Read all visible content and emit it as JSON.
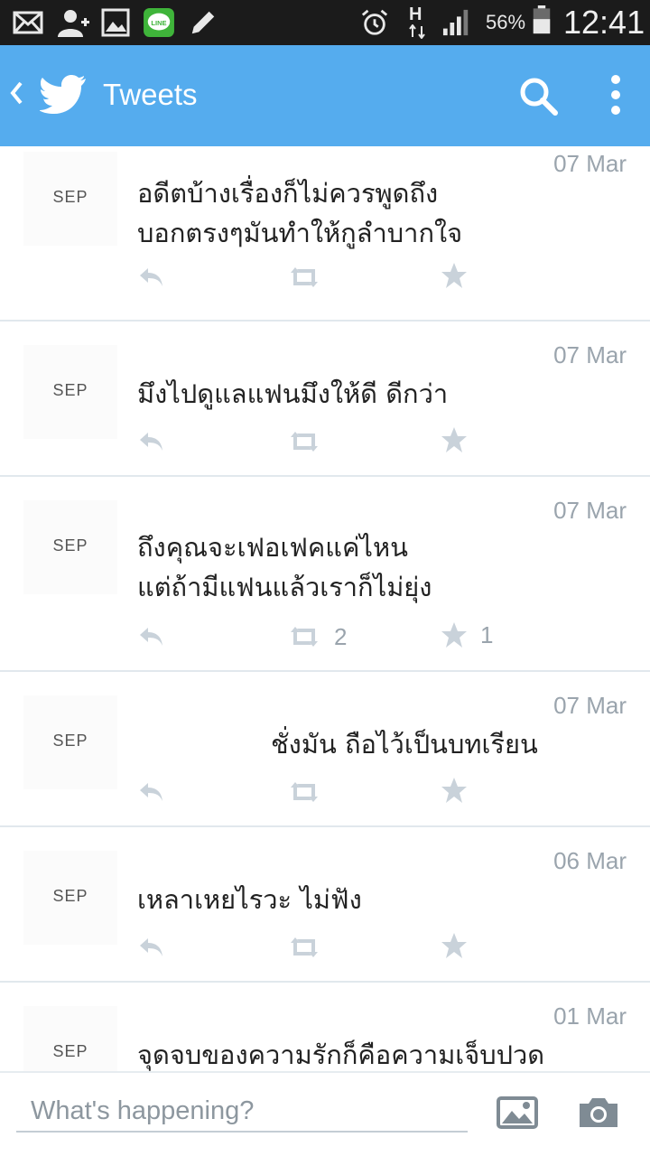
{
  "status_bar": {
    "battery_percent": "56%",
    "time": "12:41",
    "network_label": "H",
    "icons": [
      "mail-icon",
      "add-contact-icon",
      "gallery-icon",
      "line-app-icon",
      "pencil-icon",
      "alarm-icon",
      "hspa-data-icon",
      "signal-icon",
      "battery-icon"
    ]
  },
  "app_bar": {
    "title": "Tweets",
    "background": "#55acee"
  },
  "tweets": [
    {
      "avatar_label": "SEP",
      "date": "07 Mar",
      "text": "อดีตบ้างเรื่องก็ไม่ควรพูดถึง\nบอกตรงๆมันทำให้กูลำบากใจ",
      "retweets": "",
      "favorites": ""
    },
    {
      "avatar_label": "SEP",
      "date": "07 Mar",
      "text": "มึงไปดูแลแฟนมึงให้ดี ดีกว่า",
      "retweets": "",
      "favorites": ""
    },
    {
      "avatar_label": "SEP",
      "date": "07 Mar",
      "text": "ถึงคุณจะเฟอเฟคแค่ไหน\nแต่ถ้ามีแฟนแล้วเราก็ไม่ยุ่ง",
      "retweets": "2",
      "favorites": "1"
    },
    {
      "avatar_label": "SEP",
      "date": "07 Mar",
      "text": "ชั่งมัน ถือไว้เป็นบทเรียน",
      "retweets": "",
      "favorites": ""
    },
    {
      "avatar_label": "SEP",
      "date": "06 Mar",
      "text": "เหลาเหยไรวะ ไม่ฟัง",
      "retweets": "",
      "favorites": ""
    },
    {
      "avatar_label": "SEP",
      "date": "01 Mar",
      "text": "จุดจบของความรักก็คือความเจ็บปวด",
      "retweets": "",
      "favorites": ""
    }
  ],
  "compose": {
    "placeholder": "What's happening?"
  }
}
